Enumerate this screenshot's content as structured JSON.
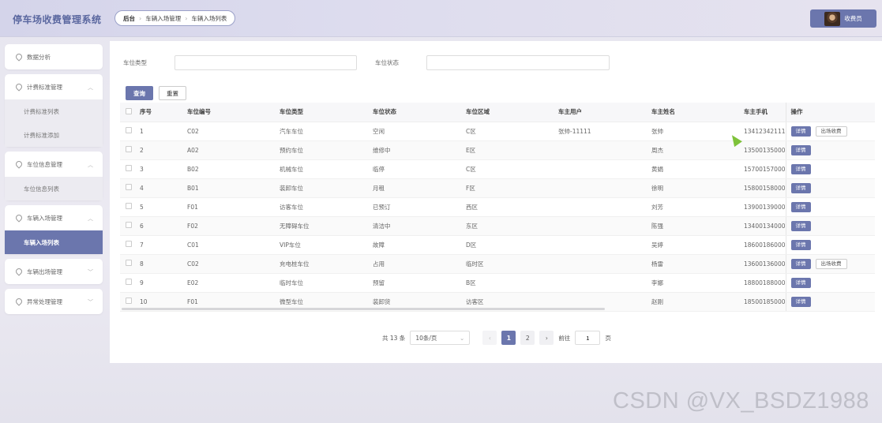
{
  "app": {
    "title": "停车场收费管理系统"
  },
  "breadcrumb": [
    "后台",
    "车辆入场管理",
    "车辆入场列表"
  ],
  "user": {
    "name": "收费员"
  },
  "sidebar": {
    "groups": [
      {
        "label": "数据分析",
        "items": []
      },
      {
        "label": "计费标准管理",
        "expanded": true,
        "items": [
          "计费标准列表",
          "计费标准添加"
        ]
      },
      {
        "label": "车位信息管理",
        "expanded": true,
        "items": [
          "车位信息列表"
        ]
      },
      {
        "label": "车辆入场管理",
        "expanded": true,
        "items": [
          "车辆入场列表"
        ]
      },
      {
        "label": "车辆出场管理",
        "expanded": false,
        "items": []
      },
      {
        "label": "异常处理管理",
        "expanded": false,
        "items": []
      }
    ],
    "active_item": "车辆入场列表"
  },
  "search": {
    "type_label": "车位类型",
    "type_value": "",
    "status_label": "车位状态",
    "status_value": "",
    "query_button": "查询",
    "reset_button": "重置"
  },
  "table": {
    "columns": [
      "序号",
      "车位编号",
      "车位类型",
      "车位状态",
      "车位区域",
      "车主用户",
      "车主姓名",
      "车主手机",
      "操作"
    ],
    "rows": [
      [
        "1",
        "C02",
        "汽车车位",
        "空闲",
        "C区",
        "张帅-11111",
        "张帅",
        "13412342111"
      ],
      [
        "2",
        "A02",
        "预约车位",
        "维修中",
        "E区",
        "",
        "周杰",
        "13500135000"
      ],
      [
        "3",
        "B02",
        "机械车位",
        "临停",
        "C区",
        "",
        "黄娟",
        "15700157000"
      ],
      [
        "4",
        "B01",
        "装卸车位",
        "月租",
        "F区",
        "",
        "徐明",
        "15800158000"
      ],
      [
        "5",
        "F01",
        "访客车位",
        "已预订",
        "西区",
        "",
        "刘芳",
        "13900139000"
      ],
      [
        "6",
        "F02",
        "无障碍车位",
        "清洁中",
        "东区",
        "",
        "陈强",
        "13400134000"
      ],
      [
        "7",
        "C01",
        "VIP车位",
        "故障",
        "D区",
        "",
        "吴婷",
        "18600186000"
      ],
      [
        "8",
        "C02",
        "充电桩车位",
        "占用",
        "临时区",
        "",
        "杨雷",
        "13600136000"
      ],
      [
        "9",
        "E02",
        "临时车位",
        "预留",
        "B区",
        "",
        "李娜",
        "18800188000"
      ],
      [
        "10",
        "F01",
        "微型车位",
        "装卸货",
        "访客区",
        "",
        "赵刚",
        "18500185000"
      ]
    ],
    "detail_label": "详情",
    "exit_label": "出场收费",
    "exit_rows": [
      0,
      7
    ]
  },
  "pager": {
    "total": "共 13 条",
    "page_size": "10条/页",
    "pages": [
      "1",
      "2"
    ],
    "current": "1",
    "goto_label": "前往",
    "goto_value": "1",
    "page_suffix": "页"
  },
  "watermark": "CSDN @VX_BSDZ1988",
  "colors": {
    "accent": "#6b76ad"
  }
}
